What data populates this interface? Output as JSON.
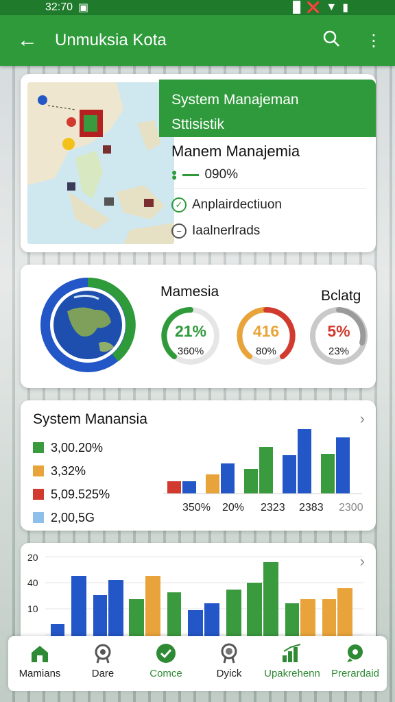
{
  "status": {
    "time": "32:70"
  },
  "appbar": {
    "title": "Unmuksia Kota"
  },
  "card1": {
    "header_line1": "System Manajeman",
    "header_line2": "Sttisistik",
    "subtitle": "Manem Manajemia",
    "progress": "090%",
    "row1": "Anplairdectiuon",
    "row2": "Iaalnerlrads"
  },
  "card2": {
    "label_left": "Mamesia",
    "label_right": "Bclatg",
    "rings": [
      {
        "big": "21%",
        "small": "360%",
        "color": "#2e9a3a",
        "big_color": "#2e9a3a"
      },
      {
        "big": "416",
        "small": "80%",
        "color": "#e8a43a",
        "big_color": "#e8a43a"
      },
      {
        "big": "5%",
        "small": "23%",
        "color": "#d23a2f",
        "big_color": "#d23a2f"
      }
    ]
  },
  "card3": {
    "title": "System Manansia",
    "legend": [
      {
        "label": "3,00.20%",
        "color": "#3a9a3e"
      },
      {
        "label": "3,32%",
        "color": "#e8a43a"
      },
      {
        "label": "5,09.525%",
        "color": "#d23a2f"
      },
      {
        "label": "2,00,5G",
        "color": "#8ebfe8"
      }
    ],
    "ticks": [
      "350%",
      "20%",
      "2323",
      "2383",
      "2300"
    ]
  },
  "card4": {
    "y_ticks": [
      "20",
      "40",
      "10"
    ]
  },
  "nav": [
    {
      "label": "Mamians",
      "icon": "home-icon"
    },
    {
      "label": "Dare",
      "icon": "badge-icon"
    },
    {
      "label": "Comce",
      "icon": "check-circle-icon"
    },
    {
      "label": "Dyick",
      "icon": "medal-icon"
    },
    {
      "label": "Upakrehenn",
      "icon": "chart-up-icon"
    },
    {
      "label": "Prerardaid",
      "icon": "location-icon"
    }
  ],
  "colors": {
    "green": "#2e9a3a",
    "blue": "#2356c6",
    "orange": "#e8a43a",
    "red": "#d23a2f"
  }
}
